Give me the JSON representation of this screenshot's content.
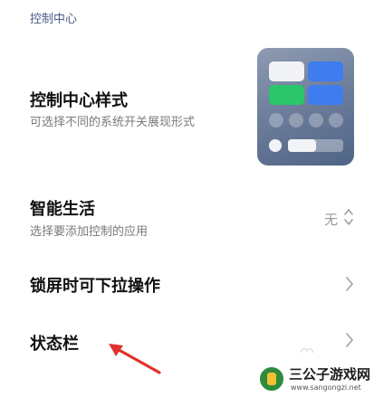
{
  "section": {
    "header": "控制中心"
  },
  "style_item": {
    "title": "控制中心样式",
    "subtitle": "可选择不同的系统开关展现形式"
  },
  "smart_life": {
    "title": "智能生活",
    "subtitle": "选择要添加控制的应用",
    "value": "无"
  },
  "lock_pull": {
    "title": "锁屏时可下拉操作"
  },
  "status_bar": {
    "title": "状态栏"
  },
  "watermark": {
    "name": "三公子游戏网",
    "url": "www.sangongzi.net"
  },
  "colors": {
    "accent_blue": "#3e7cf0",
    "accent_green": "#2bc56a",
    "annotation_red": "#e0312b",
    "section_header": "#4a5d8a"
  }
}
